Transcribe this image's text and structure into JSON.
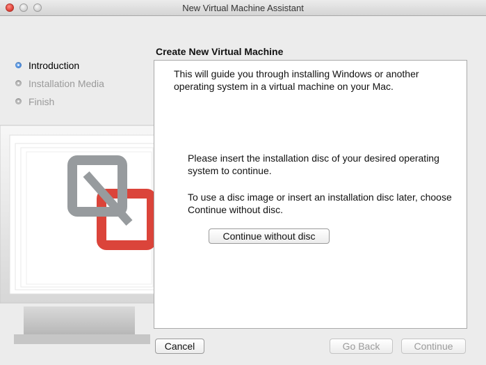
{
  "window": {
    "title": "New Virtual Machine Assistant"
  },
  "sidebar": {
    "steps": [
      {
        "label": "Introduction",
        "state": "active"
      },
      {
        "label": "Installation Media",
        "state": "inactive"
      },
      {
        "label": "Finish",
        "state": "inactive"
      }
    ]
  },
  "main": {
    "heading": "Create New Virtual Machine",
    "intro": "This will guide you through installing Windows or another operating system in a virtual machine on your Mac.",
    "insert_disc": "Please insert the installation disc of your desired operating system to continue.",
    "use_image": "To use a disc image or insert an installation disc later, choose Continue without disc.",
    "continue_without_disc_label": "Continue without disc"
  },
  "footer": {
    "cancel_label": "Cancel",
    "go_back_label": "Go Back",
    "continue_label": "Continue"
  },
  "colors": {
    "active_bullet": "#2e6fc6",
    "close_button": "#e2463c",
    "brand_red": "#d9352a",
    "brand_gray": "#8f9396"
  }
}
